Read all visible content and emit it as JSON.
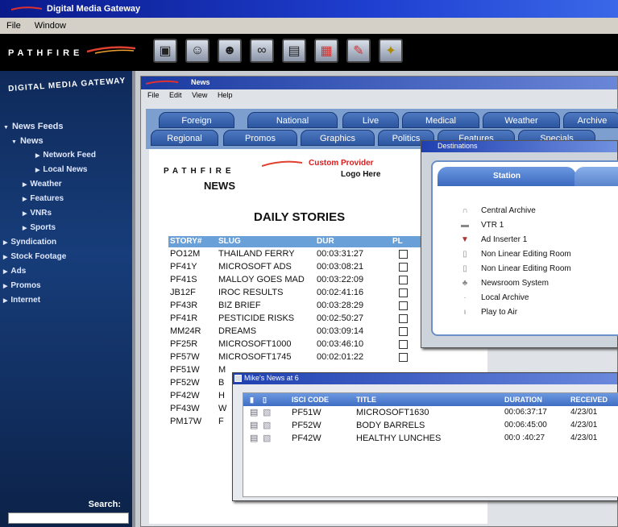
{
  "window": {
    "title": "Digital Media Gateway"
  },
  "menu": {
    "file": "File",
    "window": "Window"
  },
  "brand": {
    "text": "PATHFIRE"
  },
  "toolbar": {
    "icons": [
      "monitor-icon",
      "people-icon",
      "group-icon",
      "binoculars-icon",
      "printer-icon",
      "charts-icon",
      "notepad-icon",
      "wrench-icon"
    ]
  },
  "sidebar": {
    "heading": "DIGITAL MEDIA GATEWAY",
    "items": [
      {
        "label": "News Feeds",
        "tri": "▼"
      },
      {
        "label": "News",
        "tri": "▼"
      },
      {
        "label": "Network Feed",
        "tri": "▶"
      },
      {
        "label": "Local News",
        "tri": "▶"
      },
      {
        "label": "Weather",
        "tri": "▶"
      },
      {
        "label": "Features",
        "tri": "▶"
      },
      {
        "label": "VNRs",
        "tri": "▶"
      },
      {
        "label": "Sports",
        "tri": "▶"
      },
      {
        "label": "Syndication",
        "tri": "▶"
      },
      {
        "label": "Stock Footage",
        "tri": "▶"
      },
      {
        "label": "Ads",
        "tri": "▶"
      },
      {
        "label": "Promos",
        "tri": "▶"
      },
      {
        "label": "Internet",
        "tri": "▶"
      }
    ],
    "search_label": "Search:"
  },
  "news_window": {
    "title": "News",
    "menu": [
      "File",
      "Edit",
      "View",
      "Help"
    ],
    "tabs_row1": [
      "Foreign",
      "National",
      "Live",
      "Medical",
      "Weather",
      "Archive"
    ],
    "tabs_row2": [
      "Regional",
      "Promos",
      "Graphics",
      "Politics",
      "Features",
      "Specials"
    ],
    "brand": "PATHFIRE",
    "news_label": "NEWS",
    "custom_label": "Custom Provider",
    "logo_here": "Logo Here",
    "daily_title": "DAILY STORIES",
    "columns": [
      "STORY#",
      "SLUG",
      "DUR",
      "PL"
    ],
    "rows": [
      {
        "story": "PO12M",
        "slug": "THAILAND FERRY",
        "dur": "00:03:31:27"
      },
      {
        "story": "PF41Y",
        "slug": "MICROSOFT ADS",
        "dur": "00:03:08:21"
      },
      {
        "story": "PF41S",
        "slug": "MALLOY GOES MAD",
        "dur": "00:03:22:09"
      },
      {
        "story": "JB12F",
        "slug": "IROC RESULTS",
        "dur": "00:02:41:16"
      },
      {
        "story": "PF43R",
        "slug": "BIZ BRIEF",
        "dur": "00:03:28:29"
      },
      {
        "story": "PF41R",
        "slug": "PESTICIDE RISKS",
        "dur": "00:02:50:27"
      },
      {
        "story": "MM24R",
        "slug": "DREAMS",
        "dur": "00:03:09:14"
      },
      {
        "story": "PF25R",
        "slug": "MICROSOFT1000",
        "dur": "00:03:46:10"
      },
      {
        "story": "PF57W",
        "slug": "MICROSOFT1745",
        "dur": "00:02:01:22"
      },
      {
        "story": "PF51W",
        "slug": "M",
        "dur": ""
      },
      {
        "story": "PF52W",
        "slug": "B",
        "dur": ""
      },
      {
        "story": "PF42W",
        "slug": "H",
        "dur": ""
      },
      {
        "story": "PF43W",
        "slug": "W",
        "dur": ""
      },
      {
        "story": "PM17W",
        "slug": "F",
        "dur": ""
      }
    ]
  },
  "destinations": {
    "title": "Destinations",
    "station_tab": "Station",
    "items": [
      "Central Archive",
      "VTR 1",
      "Ad Inserter 1",
      "Non Linear Editing Room",
      "Non Linear Editing Room",
      "Newsroom System",
      "Local Archive",
      "Play to Air"
    ]
  },
  "mikes_news": {
    "title": "Mike's News at 6",
    "columns": [
      "ISCI CODE",
      "TITLE",
      "DURATION",
      "RECEIVED"
    ],
    "rows": [
      {
        "code": "PF51W",
        "title": "MICROSOFT1630",
        "dur": "00:06:37:17",
        "date": "4/23/01"
      },
      {
        "code": "PF52W",
        "title": "BODY BARRELS",
        "dur": "00:06:45:00",
        "date": "4/23/01"
      },
      {
        "code": "PF42W",
        "title": "HEALTHY LUNCHES",
        "dur": "00:0 :40:27",
        "date": "4/23/01"
      }
    ]
  }
}
